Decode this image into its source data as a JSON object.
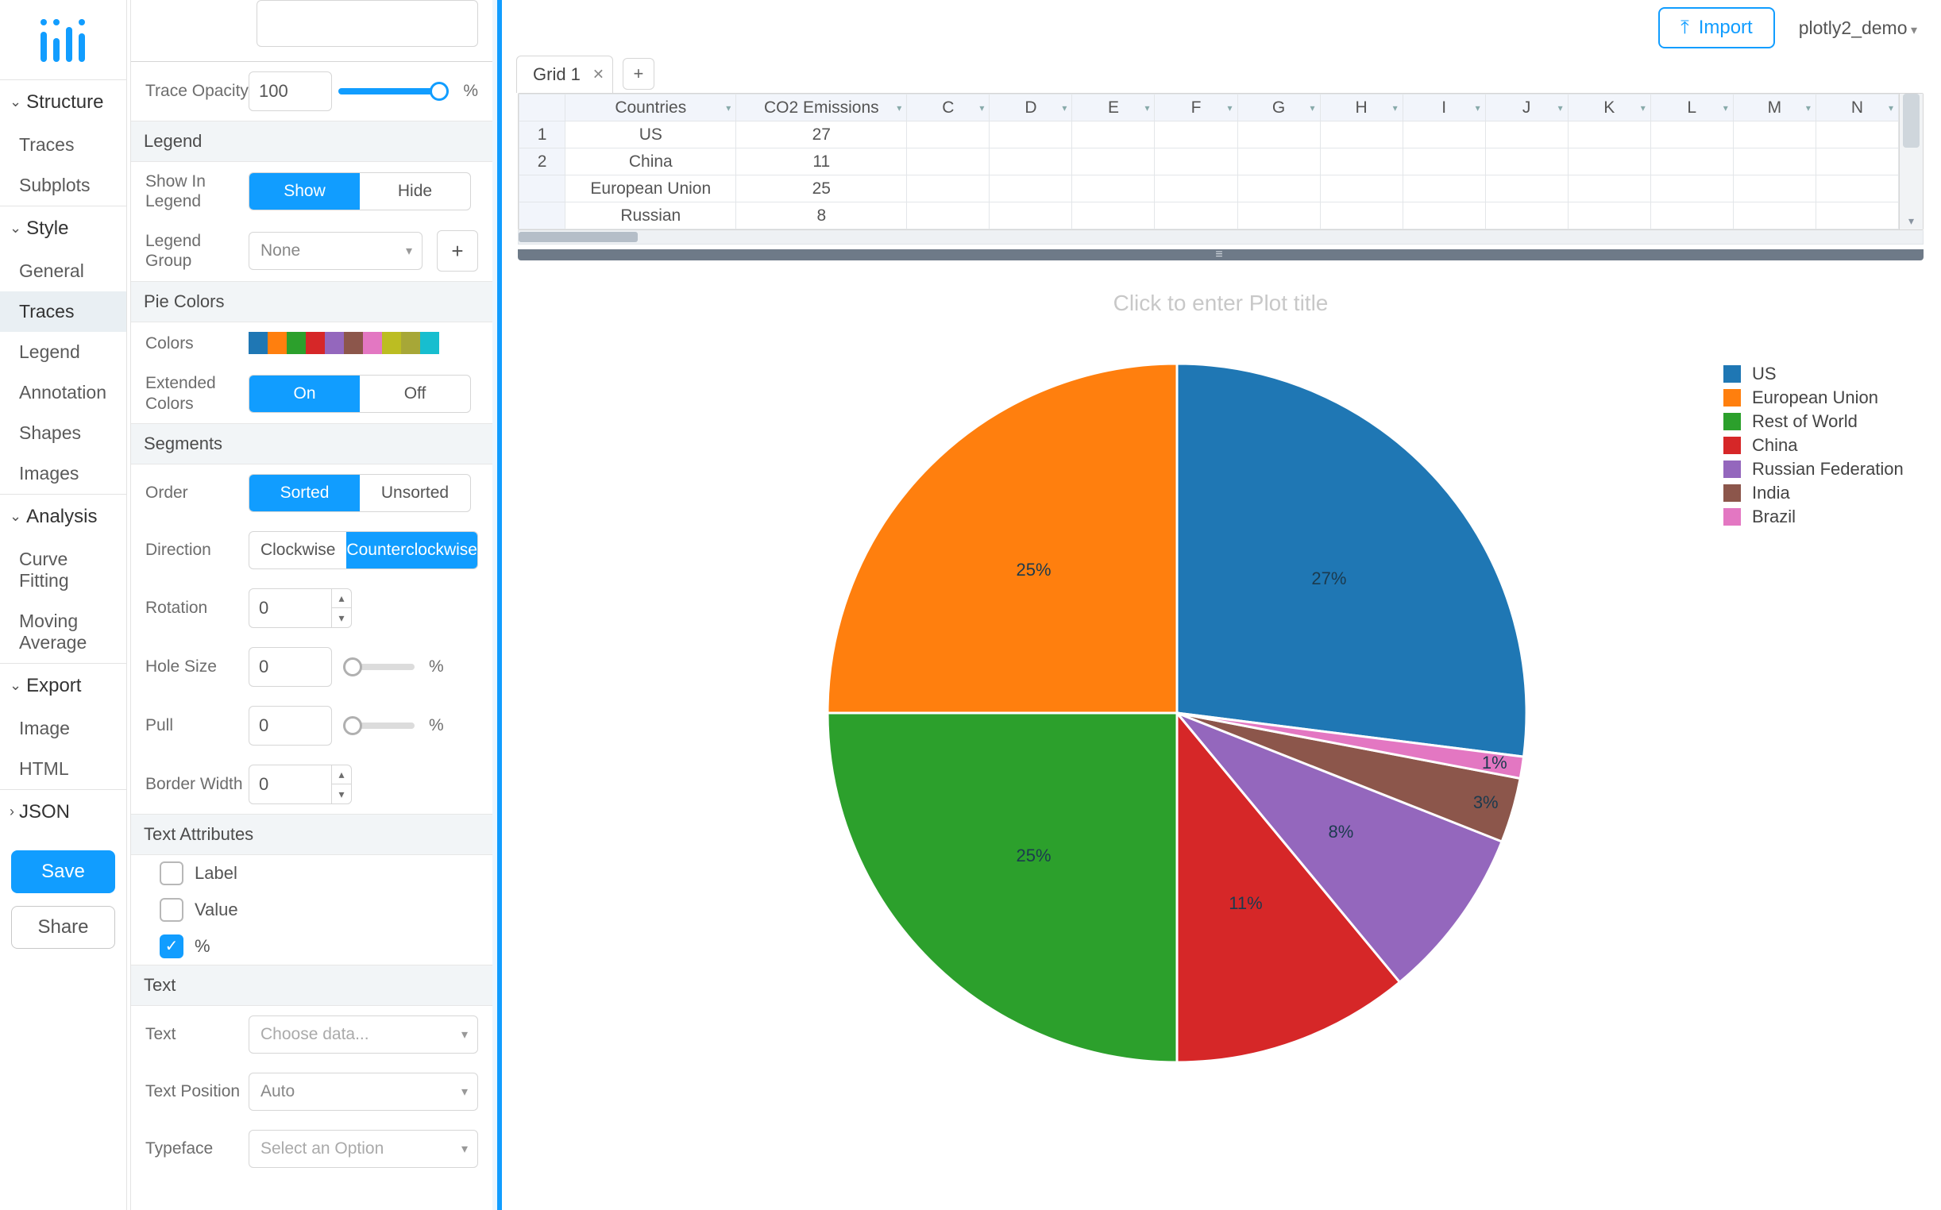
{
  "user": "plotly2_demo",
  "import_label": "Import",
  "nav": {
    "structure": {
      "label": "Structure",
      "items": [
        "Traces",
        "Subplots"
      ]
    },
    "style": {
      "label": "Style",
      "items": [
        "General",
        "Traces",
        "Legend",
        "Annotation",
        "Shapes",
        "Images"
      ],
      "active": "Traces"
    },
    "analysis": {
      "label": "Analysis",
      "items": [
        "Curve Fitting",
        "Moving Average"
      ]
    },
    "export": {
      "label": "Export",
      "items": [
        "Image",
        "HTML"
      ]
    },
    "json": {
      "label": "JSON"
    }
  },
  "buttons": {
    "save": "Save",
    "share": "Share"
  },
  "panel": {
    "trace_opacity": {
      "label": "Trace Opacity",
      "value": "100",
      "unit": "%"
    },
    "legend": {
      "section": "Legend",
      "show_in_legend": {
        "label": "Show In Legend",
        "options": [
          "Show",
          "Hide"
        ],
        "selected": "Show"
      },
      "legend_group": {
        "label": "Legend Group",
        "value": "None"
      }
    },
    "pie_colors": {
      "section": "Pie Colors",
      "colors_label": "Colors",
      "extended": {
        "label": "Extended Colors",
        "options": [
          "On",
          "Off"
        ],
        "selected": "On"
      }
    },
    "swatches": [
      "#1f77b4",
      "#ff7f0e",
      "#2ca02c",
      "#d62728",
      "#9467bd",
      "#8c564b",
      "#e377c2",
      "#bcbd22",
      "#a7a737",
      "#17becf"
    ],
    "segments": {
      "section": "Segments",
      "order": {
        "label": "Order",
        "options": [
          "Sorted",
          "Unsorted"
        ],
        "selected": "Sorted"
      },
      "direction": {
        "label": "Direction",
        "options": [
          "Clockwise",
          "Counterclockwise"
        ],
        "selected": "Counterclockwise"
      },
      "rotation": {
        "label": "Rotation",
        "value": "0"
      },
      "hole": {
        "label": "Hole Size",
        "value": "0",
        "unit": "%"
      },
      "pull": {
        "label": "Pull",
        "value": "0",
        "unit": "%"
      },
      "border": {
        "label": "Border Width",
        "value": "0"
      }
    },
    "text_attr": {
      "section": "Text Attributes",
      "label": {
        "label": "Label",
        "checked": false
      },
      "value": {
        "label": "Value",
        "checked": false
      },
      "percent": {
        "label": "%",
        "checked": true
      }
    },
    "text": {
      "section": "Text",
      "text": {
        "label": "Text",
        "placeholder": "Choose data..."
      },
      "position": {
        "label": "Text Position",
        "value": "Auto"
      },
      "typeface": {
        "label": "Typeface",
        "placeholder": "Select an Option"
      }
    }
  },
  "grid": {
    "tab": "Grid 1",
    "headers": [
      "Countries",
      "CO2 Emissions",
      "C",
      "D",
      "E",
      "F",
      "G",
      "H",
      "I",
      "J",
      "K",
      "L",
      "M",
      "N"
    ],
    "rows": [
      {
        "n": "1",
        "country": "US",
        "value": "27"
      },
      {
        "n": "2",
        "country": "China",
        "value": "11"
      },
      {
        "n": "",
        "country": "European Union",
        "value": "25"
      },
      {
        "n": "",
        "country": "Russian",
        "value": "8"
      }
    ]
  },
  "chart": {
    "title_placeholder": "Click to enter Plot title",
    "legend_items": [
      {
        "label": "US",
        "color": "#1f77b4"
      },
      {
        "label": "European Union",
        "color": "#ff7f0e"
      },
      {
        "label": "Rest of World",
        "color": "#2ca02c"
      },
      {
        "label": "China",
        "color": "#d62728"
      },
      {
        "label": "Russian Federation",
        "color": "#9467bd"
      },
      {
        "label": "India",
        "color": "#8c564b"
      },
      {
        "label": "Brazil",
        "color": "#e377c2"
      }
    ]
  },
  "chart_data": {
    "type": "pie",
    "title": "",
    "sorted": true,
    "direction": "counterclockwise",
    "rotation": 0,
    "slices": [
      {
        "label": "US",
        "percent": 27,
        "color": "#1f77b4"
      },
      {
        "label": "European Union",
        "percent": 25,
        "color": "#ff7f0e"
      },
      {
        "label": "Rest of World",
        "percent": 25,
        "color": "#2ca02c"
      },
      {
        "label": "China",
        "percent": 11,
        "color": "#d62728"
      },
      {
        "label": "Russian Federation",
        "percent": 8,
        "color": "#9467bd"
      },
      {
        "label": "India",
        "percent": 3,
        "color": "#8c564b"
      },
      {
        "label": "Brazil",
        "percent": 1,
        "color": "#e377c2"
      }
    ]
  }
}
